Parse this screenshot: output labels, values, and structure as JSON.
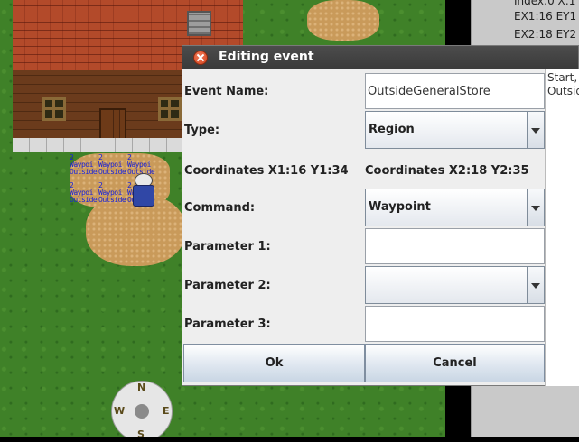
{
  "sidebar": {
    "line1": "Index:0 X:1",
    "line2": "EX1:16 EY1",
    "line3": "EX2:18 EY2"
  },
  "map": {
    "waypoint_labels": [
      {
        "num": "2",
        "line1": "Waypoi",
        "line2": "Outside"
      },
      {
        "num": "2",
        "line1": "Waypoi",
        "line2": "Outside"
      },
      {
        "num": "2",
        "line1": "Waypoi",
        "line2": "Outside"
      },
      {
        "num": "2",
        "line1": "Waypoi",
        "line2": "Outside"
      },
      {
        "num": "2",
        "line1": "Waypoi",
        "line2": "Outside"
      },
      {
        "num": "2",
        "line1": "Waypoi",
        "line2": "Outside"
      }
    ],
    "compass": {
      "n": "N",
      "e": "E",
      "s": "S",
      "w": "W"
    }
  },
  "dialog": {
    "title": "Editing event",
    "event_name_label": "Event Name:",
    "event_name_value": "OutsideGeneralStore",
    "type_label": "Type:",
    "type_value": "Region",
    "coords1": "Coordinates X1:16 Y1:34",
    "coords2": "Coordinates X2:18 Y2:35",
    "command_label": "Command:",
    "command_value": "Waypoint",
    "param1_label": "Parameter 1:",
    "param1_value": "",
    "param2_label": "Parameter 2:",
    "param2_value": "",
    "param3_label": "Parameter 3:",
    "param3_value": "",
    "ok_label": "Ok",
    "cancel_label": "Cancel",
    "side_line1": "Start,",
    "side_line2": "Outsid"
  },
  "colors": {
    "waypoint_text": "#1a22d8",
    "titlebar": "#3f3f3f",
    "close_button": "#e05a33"
  }
}
